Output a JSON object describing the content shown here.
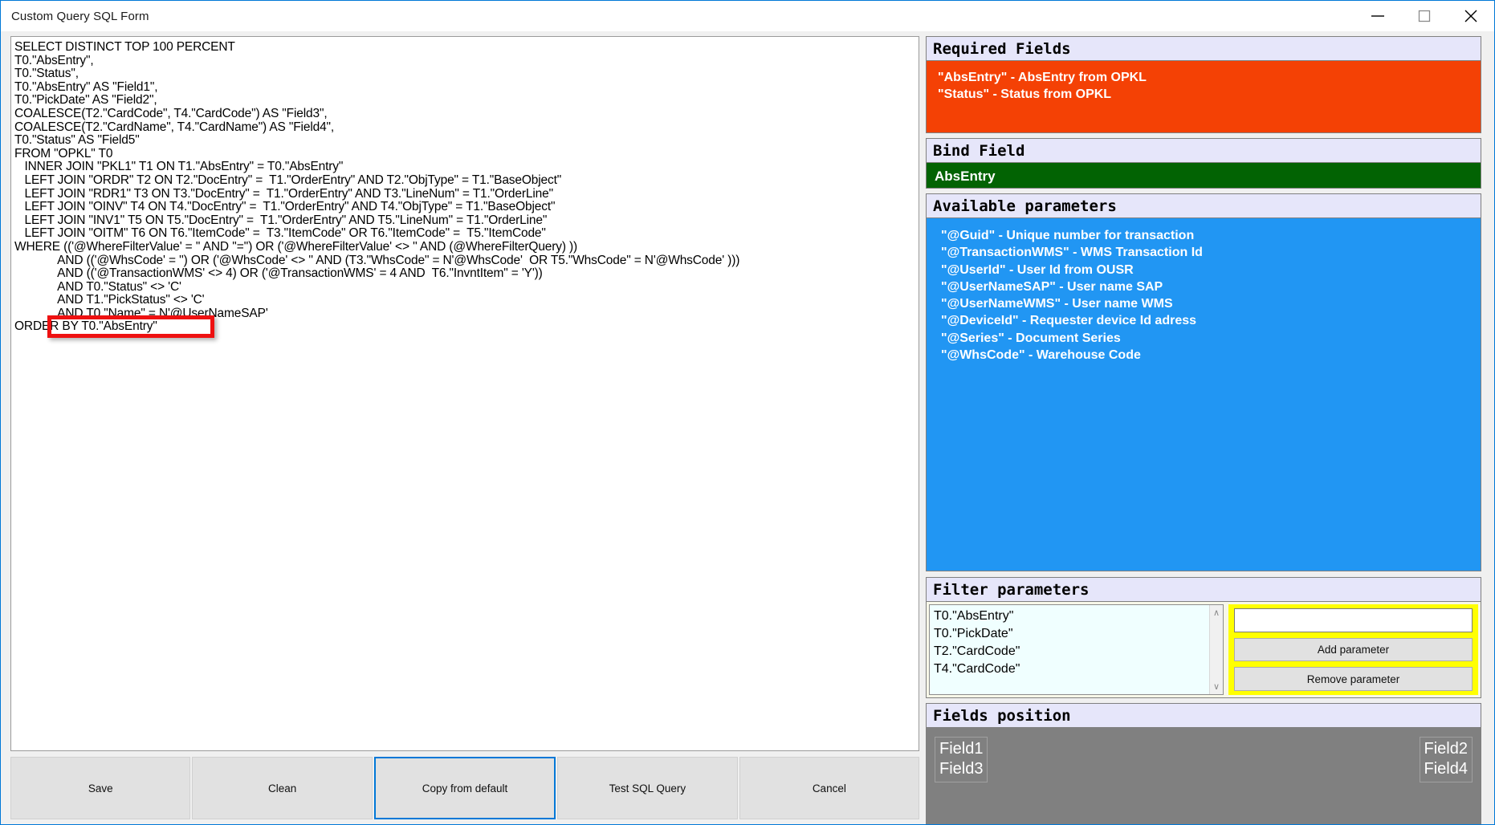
{
  "window": {
    "title": "Custom Query SQL Form",
    "controls": [
      {
        "name": "minimize",
        "glyph": "minimize-icon"
      },
      {
        "name": "maximize",
        "glyph": "maximize-icon"
      },
      {
        "name": "close",
        "glyph": "close-icon"
      }
    ]
  },
  "editor": {
    "sql": "SELECT DISTINCT TOP 100 PERCENT\nT0.\"AbsEntry\",\nT0.\"Status\",\nT0.\"AbsEntry\" AS \"Field1\",\nT0.\"PickDate\" AS \"Field2\",\nCOALESCE(T2.\"CardCode\", T4.\"CardCode\") AS \"Field3\",\nCOALESCE(T2.\"CardName\", T4.\"CardName\") AS \"Field4\",\nT0.\"Status\" AS \"Field5\"\nFROM \"OPKL\" T0\n   INNER JOIN \"PKL1\" T1 ON T1.\"AbsEntry\" = T0.\"AbsEntry\"\n   LEFT JOIN \"ORDR\" T2 ON T2.\"DocEntry\" =  T1.\"OrderEntry\" AND T2.\"ObjType\" = T1.\"BaseObject\"\n   LEFT JOIN \"RDR1\" T3 ON T3.\"DocEntry\" =  T1.\"OrderEntry\" AND T3.\"LineNum\" = T1.\"OrderLine\"\n   LEFT JOIN \"OINV\" T4 ON T4.\"DocEntry\" =  T1.\"OrderEntry\" AND T4.\"ObjType\" = T1.\"BaseObject\"\n   LEFT JOIN \"INV1\" T5 ON T5.\"DocEntry\" =  T1.\"OrderEntry\" AND T5.\"LineNum\" = T1.\"OrderLine\"\n   LEFT JOIN \"OITM\" T6 ON T6.\"ItemCode\" =  T3.\"ItemCode\" OR T6.\"ItemCode\" =  T5.\"ItemCode\"\nWHERE (('@WhereFilterValue' = '' AND ''='') OR ('@WhereFilterValue' <> '' AND (@WhereFilterQuery) ))\n             AND (('@WhsCode' = '') OR ('@WhsCode' <> '' AND (T3.\"WhsCode\" = N'@WhsCode'  OR T5.\"WhsCode\" = N'@WhsCode' )))\n             AND (('@TransactionWMS' <> 4) OR ('@TransactionWMS' = 4 AND  T6.\"InvntItem\" = 'Y'))\n             AND T0.\"Status\" <> 'C'\n             AND T1.\"PickStatus\" <> 'C'\n             AND T0.\"Name\" = N'@UserNameSAP'\nORDER BY T0.\"AbsEntry\"",
    "highlight_note": "AND T0.\"Status\" <> 'C'"
  },
  "buttons": {
    "save": "Save",
    "clean": "Clean",
    "copy_from_default": "Copy from default",
    "test_sql_query": "Test SQL Query",
    "cancel": "Cancel"
  },
  "required_fields": {
    "header": "Required Fields",
    "body": "\"AbsEntry\" - AbsEntry from OPKL\n\"Status\" - Status from OPKL"
  },
  "bind_field": {
    "header": "Bind Field",
    "value": "AbsEntry"
  },
  "available_parameters": {
    "header": "Available parameters",
    "body": "\"@Guid\" - Unique number for transaction\n\"@TransactionWMS\" - WMS Transaction Id\n\"@UserId\" - User Id from OUSR\n\"@UserNameSAP\" - User name SAP\n\"@UserNameWMS\" - User name WMS\n\"@DeviceId\" - Requester device Id adress\n\"@Series\" - Document Series\n\"@WhsCode\" - Warehouse Code"
  },
  "filter_parameters": {
    "header": "Filter parameters",
    "list": "T0.\"AbsEntry\"\nT0.\"PickDate\"\nT2.\"CardCode\"\nT4.\"CardCode\"",
    "input_value": "",
    "input_placeholder": "",
    "add_label": "Add parameter",
    "remove_label": "Remove parameter",
    "scroll_up": "∧",
    "scroll_down": "∨"
  },
  "fields_position": {
    "header": "Fields position",
    "left_group": "Field1\nField3",
    "right_group": "Field2\nField4"
  },
  "colors": {
    "accent": "#0078d7",
    "required_bg": "#f44105",
    "bind_bg": "#026303",
    "params_bg": "#2196f3",
    "filter_bg": "#ffff00",
    "fields_bg": "#808080",
    "highlight_border": "#ee1111"
  }
}
